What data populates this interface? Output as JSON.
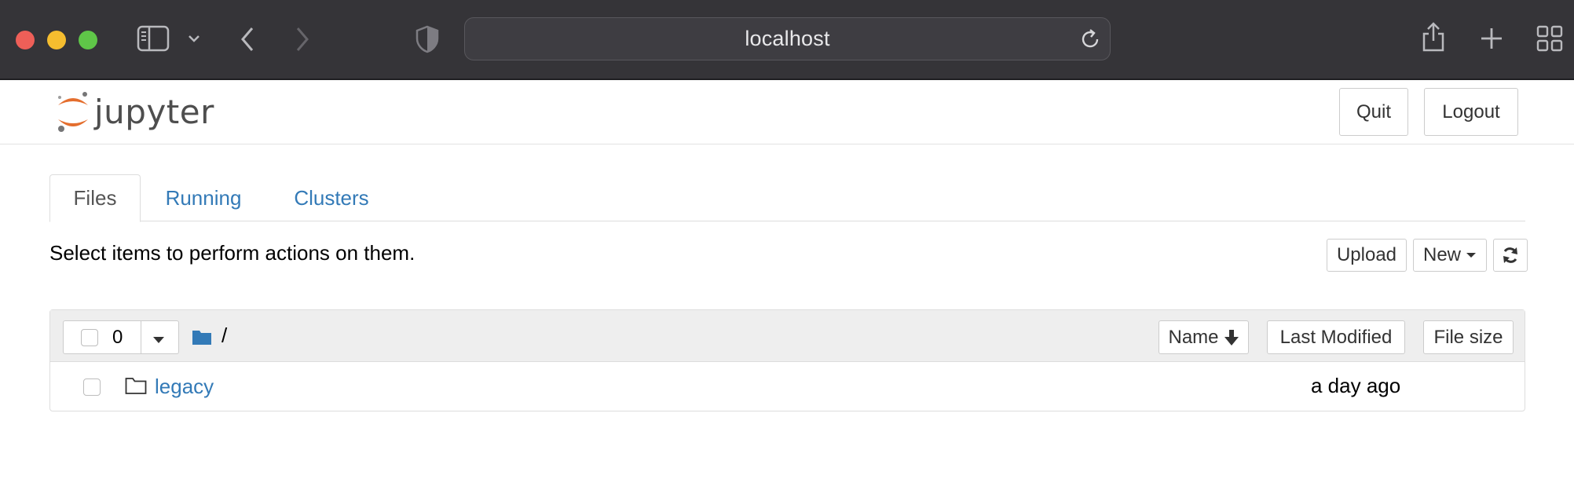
{
  "browser": {
    "url": "localhost"
  },
  "header": {
    "logo_text": "jupyter",
    "quit_label": "Quit",
    "logout_label": "Logout"
  },
  "tabs": [
    {
      "label": "Files",
      "active": true
    },
    {
      "label": "Running",
      "active": false
    },
    {
      "label": "Clusters",
      "active": false
    }
  ],
  "toolbar": {
    "hint": "Select items to perform actions on them.",
    "upload_label": "Upload",
    "new_label": "New"
  },
  "file_list": {
    "selected_count": "0",
    "breadcrumb": "/",
    "sort_name_label": "Name",
    "sort_modified_label": "Last Modified",
    "sort_size_label": "File size",
    "items": [
      {
        "name": "legacy",
        "type": "folder",
        "modified": "a day ago",
        "size": ""
      }
    ]
  },
  "colors": {
    "link": "#337ab7",
    "chrome_bg": "#353438",
    "logo_orange": "#e46e2e"
  }
}
